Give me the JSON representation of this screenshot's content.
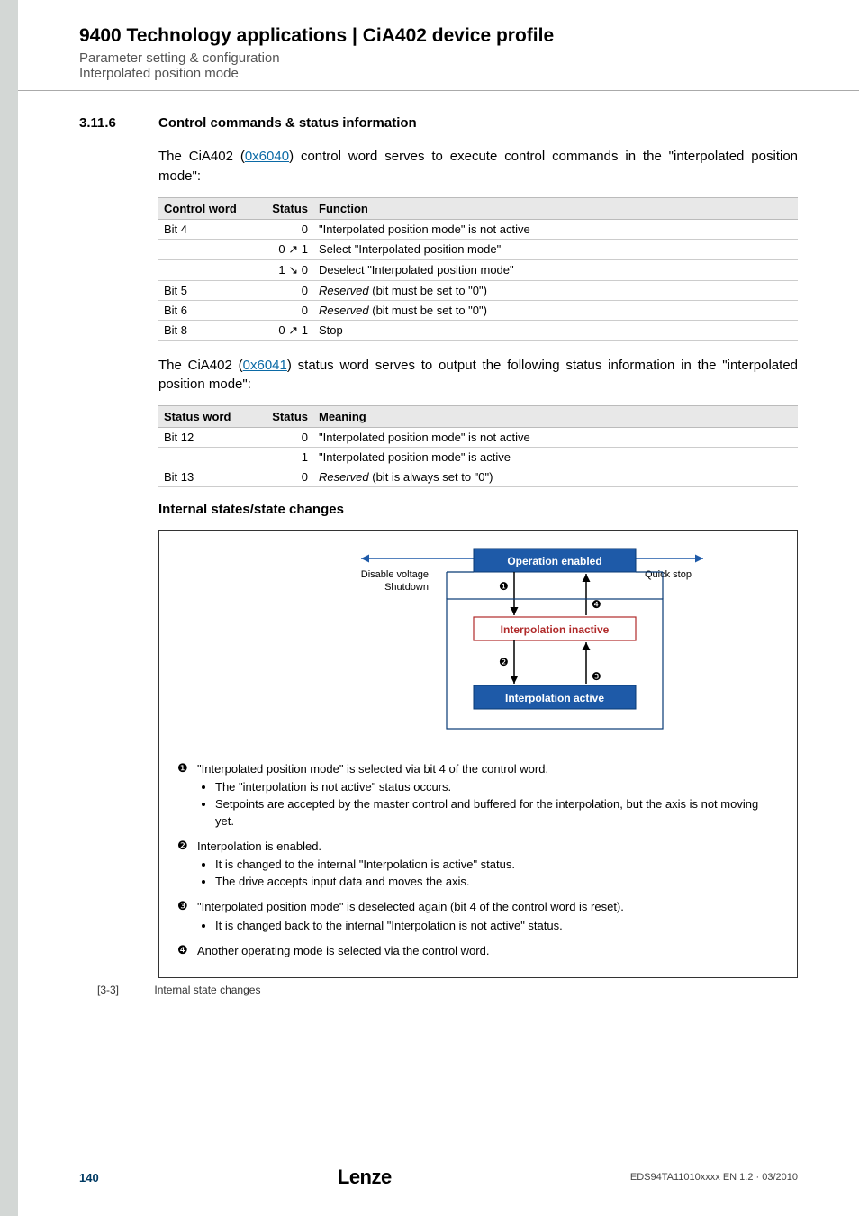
{
  "header": {
    "title": "9400 Technology applications | CiA402 device profile",
    "sub1": "Parameter setting & configuration",
    "sub2": "Interpolated position mode"
  },
  "section": {
    "num": "3.11.6",
    "title": "Control commands & status information"
  },
  "intro1": {
    "pre": "The CiA402 (",
    "link": "0x6040",
    "post": ") control word serves to execute control commands in the \"interpolated position mode\":"
  },
  "table1": {
    "h1": "Control word",
    "h2": "Status",
    "h3": "Function",
    "rows": [
      {
        "c1": "Bit 4",
        "c2": "0",
        "c3": "\"Interpolated position mode\" is not active"
      },
      {
        "c1": "",
        "c2": "0 ↗ 1",
        "c3": "Select \"Interpolated position mode\""
      },
      {
        "c1": "",
        "c2": "1 ↘ 0",
        "c3": "Deselect \"Interpolated position mode\""
      },
      {
        "c1": "Bit 5",
        "c2": "0",
        "c3i": "Reserved",
        "c3": " (bit must be set to \"0\")"
      },
      {
        "c1": "Bit 6",
        "c2": "0",
        "c3i": "Reserved",
        "c3": " (bit must be set to \"0\")"
      },
      {
        "c1": "Bit 8",
        "c2": "0 ↗ 1",
        "c3": "Stop"
      }
    ]
  },
  "intro2": {
    "pre": "The CiA402 (",
    "link": "0x6041",
    "post": ") status word serves to output the following status information in the \"interpolated position mode\":"
  },
  "table2": {
    "h1": "Status word",
    "h2": "Status",
    "h3": "Meaning",
    "rows": [
      {
        "c1": "Bit 12",
        "c2": "0",
        "c3": "\"Interpolated position mode\" is not active"
      },
      {
        "c1": "",
        "c2": "1",
        "c3": "\"Interpolated position mode\" is active"
      },
      {
        "c1": "Bit 13",
        "c2": "0",
        "c3i": "Reserved",
        "c3": " (bit is always set to \"0\")"
      }
    ]
  },
  "subhead": "Internal states/state changes",
  "diagram": {
    "top": "Operation enabled",
    "mid": "Interpolation inactive",
    "bot": "Interpolation active",
    "left1": "Disable voltage",
    "left2": "Shutdown",
    "right": "Quick stop",
    "m1": "❶",
    "m2": "❷",
    "m3": "❸",
    "m4": "❹"
  },
  "legend": [
    {
      "n": "❶",
      "head": "\"Interpolated position mode\" is selected via bit 4 of the control word.",
      "bullets": [
        "The \"interpolation is not active\" status occurs.",
        "Setpoints are accepted by the master control and buffered for the interpolation, but the axis is not moving yet."
      ]
    },
    {
      "n": "❷",
      "head": "Interpolation is enabled.",
      "bullets": [
        "It is changed to the internal \"Interpolation is active\" status.",
        "The drive accepts input data and moves the axis."
      ]
    },
    {
      "n": "❸",
      "head": "\"Interpolated position mode\" is deselected again (bit 4 of the control word is reset).",
      "bullets": [
        "It is changed back to the internal \"Interpolation is not active\" status."
      ]
    },
    {
      "n": "❹",
      "head": "Another operating mode is selected via the control word.",
      "bullets": []
    }
  ],
  "caption": {
    "num": "[3-3]",
    "text": "Internal state changes"
  },
  "footer": {
    "page": "140",
    "logo": "Lenze",
    "doc": "EDS94TA11010xxxx EN 1.2 · 03/2010"
  }
}
